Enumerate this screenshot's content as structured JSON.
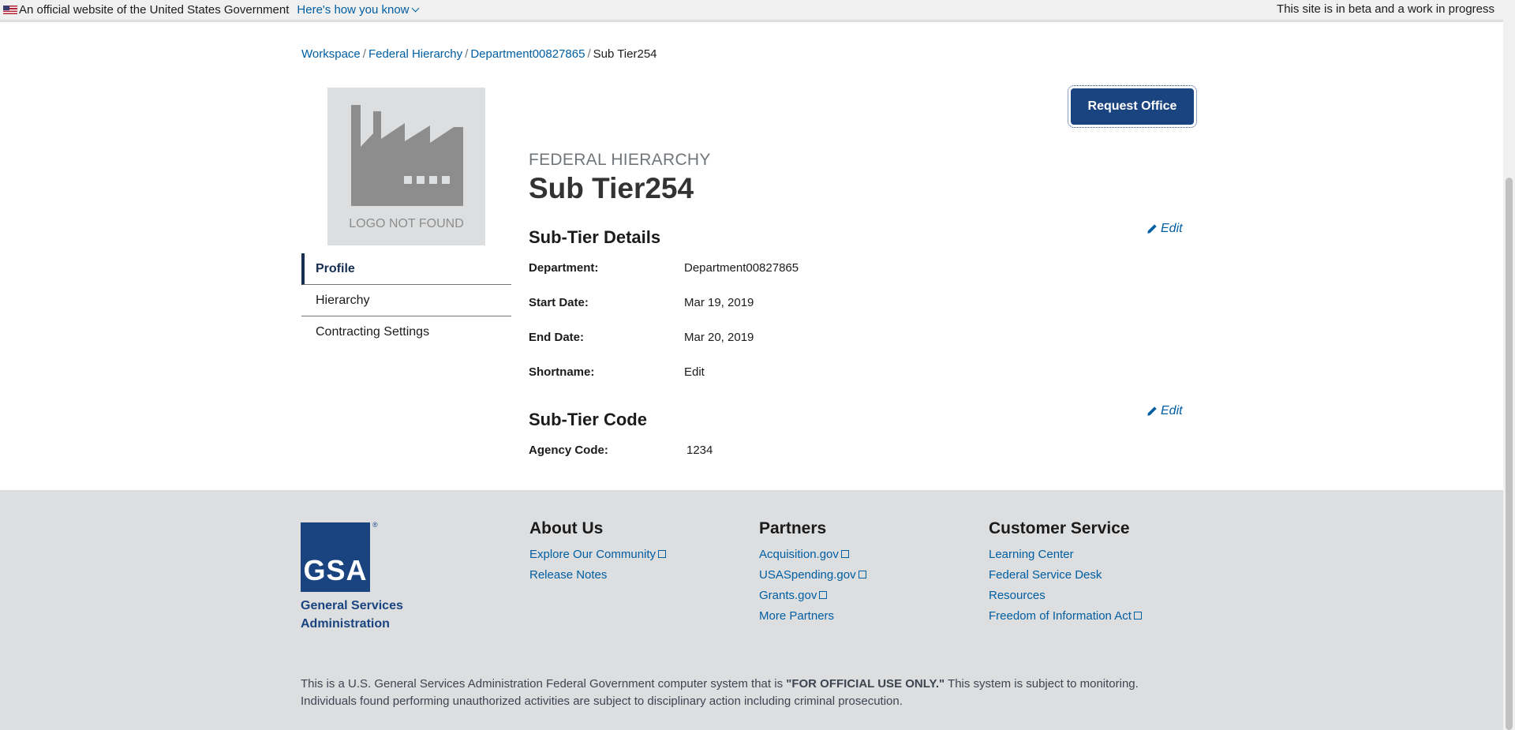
{
  "banner": {
    "official_text": "An official website of the United States Government",
    "how_link": "Here's how you know",
    "beta_text": "This site is in beta and a work in progress"
  },
  "breadcrumb": {
    "items": [
      "Workspace",
      "Federal Hierarchy",
      "Department00827865"
    ],
    "current": "Sub Tier254"
  },
  "logo": {
    "placeholder_text": "LOGO NOT FOUND"
  },
  "sidenav": {
    "items": [
      "Profile",
      "Hierarchy",
      "Contracting Settings"
    ]
  },
  "actions": {
    "request_office": "Request Office"
  },
  "header": {
    "eyebrow": "FEDERAL HIERARCHY",
    "title": "Sub Tier254"
  },
  "details": {
    "title": "Sub-Tier Details",
    "edit": "Edit",
    "rows": [
      {
        "label": "Department:",
        "value": "Department00827865"
      },
      {
        "label": "Start Date:",
        "value": "Mar 19, 2019"
      },
      {
        "label": "End Date:",
        "value": "Mar 20, 2019"
      },
      {
        "label": "Shortname:",
        "value": "Edit"
      }
    ]
  },
  "code": {
    "title": "Sub-Tier Code",
    "edit": "Edit",
    "rows": [
      {
        "label": "Agency Code:",
        "value": "1234"
      }
    ]
  },
  "footer": {
    "gsa_mark": "GSA",
    "gsa_reg": "®",
    "gsa_name_1": "General Services",
    "gsa_name_2": "Administration",
    "about": {
      "title": "About Us",
      "links": [
        "Explore Our Community",
        "Release Notes"
      ]
    },
    "partners": {
      "title": "Partners",
      "links": [
        "Acquisition.gov",
        "USASpending.gov",
        "Grants.gov",
        "More Partners"
      ]
    },
    "service": {
      "title": "Customer Service",
      "links": [
        "Learning Center",
        "Federal Service Desk",
        "Resources",
        "Freedom of Information Act"
      ]
    },
    "disclaimer_pre": "This is a U.S. General Services Administration Federal Government computer system that is ",
    "disclaimer_bold": "\"FOR OFFICIAL USE ONLY.\"",
    "disclaimer_post": " This system is subject to monitoring. Individuals found performing unauthorized activities are subject to disciplinary action including criminal prosecution."
  }
}
